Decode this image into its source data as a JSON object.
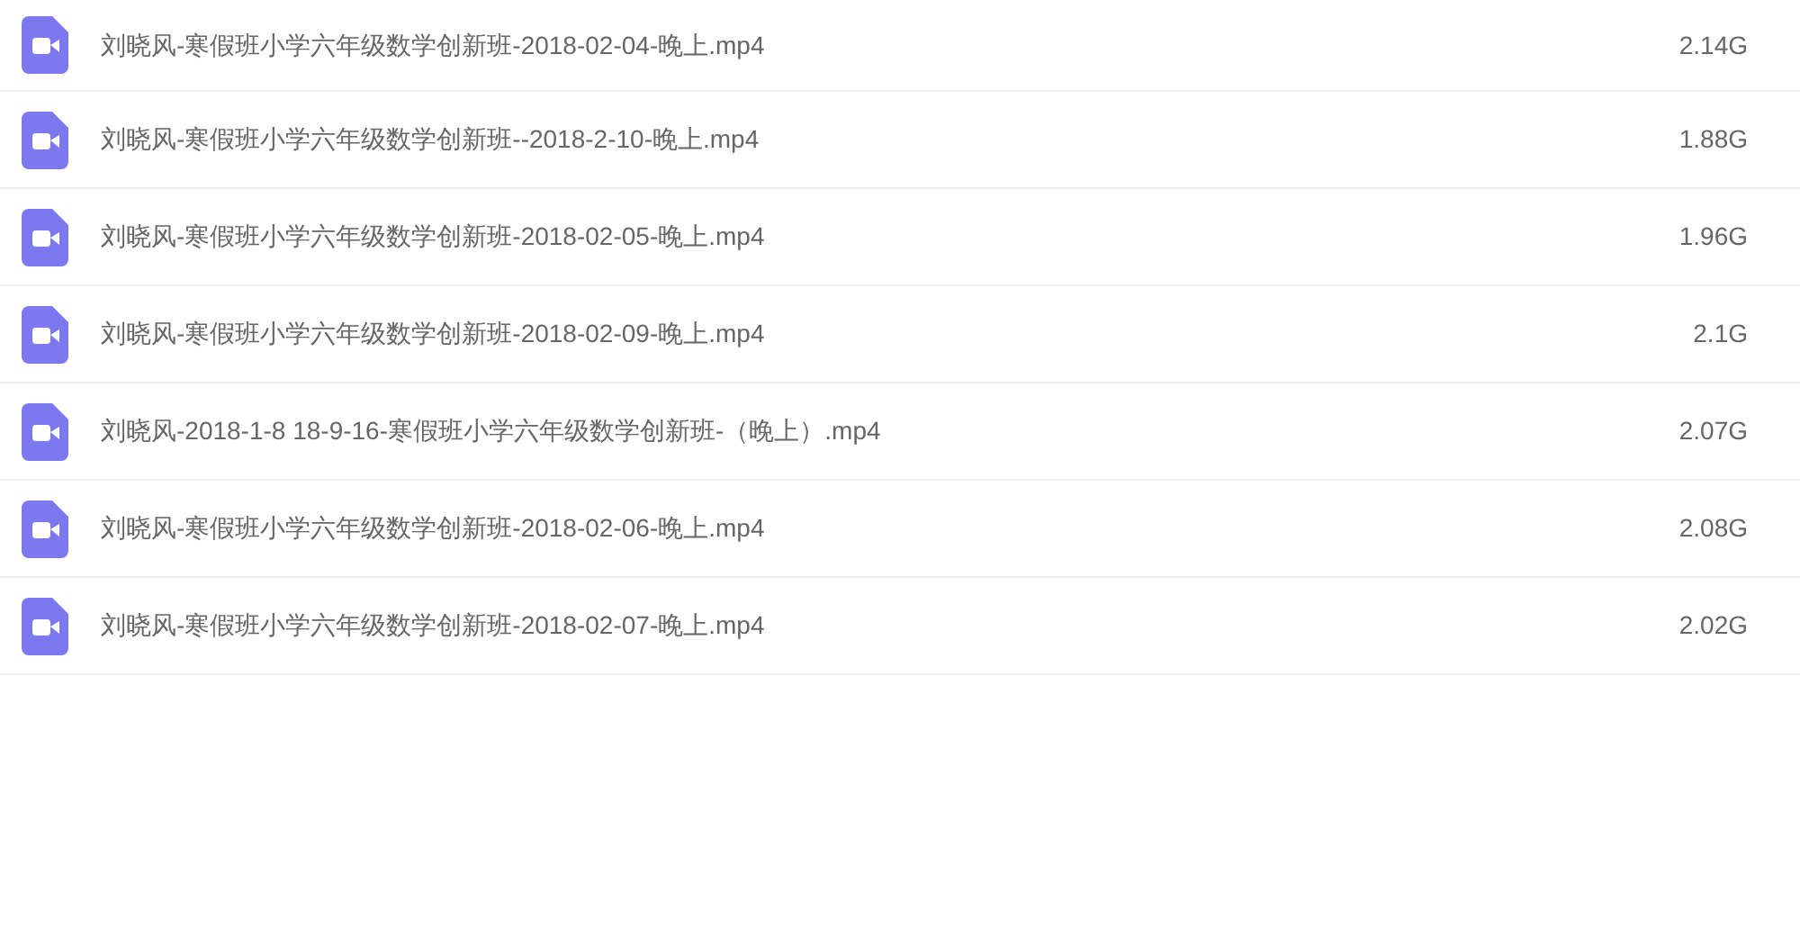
{
  "files": [
    {
      "name": "刘晓风-寒假班小学六年级数学创新班-2018-02-04-晚上.mp4",
      "size": "2.14G"
    },
    {
      "name": "刘晓风-寒假班小学六年级数学创新班--2018-2-10-晚上.mp4",
      "size": "1.88G"
    },
    {
      "name": "刘晓风-寒假班小学六年级数学创新班-2018-02-05-晚上.mp4",
      "size": "1.96G"
    },
    {
      "name": "刘晓风-寒假班小学六年级数学创新班-2018-02-09-晚上.mp4",
      "size": "2.1G"
    },
    {
      "name": "刘晓风-2018-1-8 18-9-16-寒假班小学六年级数学创新班-（晚上）.mp4",
      "size": "2.07G"
    },
    {
      "name": "刘晓风-寒假班小学六年级数学创新班-2018-02-06-晚上.mp4",
      "size": "2.08G"
    },
    {
      "name": "刘晓风-寒假班小学六年级数学创新班-2018-02-07-晚上.mp4",
      "size": "2.02G"
    }
  ]
}
